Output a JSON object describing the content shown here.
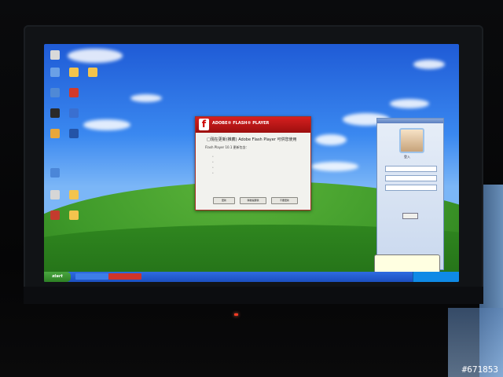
{
  "desktop": {
    "icons": [
      {
        "label": ""
      },
      {
        "label": ""
      },
      {
        "label": ""
      },
      {
        "label": ""
      },
      {
        "label": ""
      },
      {
        "label": ""
      },
      {
        "label": ""
      },
      {
        "label": ""
      },
      {
        "label": ""
      },
      {
        "label": ""
      }
    ]
  },
  "dialog": {
    "header_text": "ADOBE® FLASH® PLAYER",
    "title": "□現在更新(推薦) Adobe Flash Player 可供您使用",
    "subtitle": "Flash Player 10.1 更新包含：",
    "bullets": [
      "",
      "",
      "",
      ""
    ],
    "note": "",
    "buttons": [
      "更新",
      "稍後提醒我",
      "不要更新"
    ]
  },
  "login": {
    "title": "登入",
    "account_label": "",
    "status_label": "",
    "button": ""
  },
  "balloon": {
    "text": ""
  },
  "taskbar": {
    "start_label": "start",
    "items": [
      "",
      ""
    ]
  },
  "watermark": "#671853"
}
